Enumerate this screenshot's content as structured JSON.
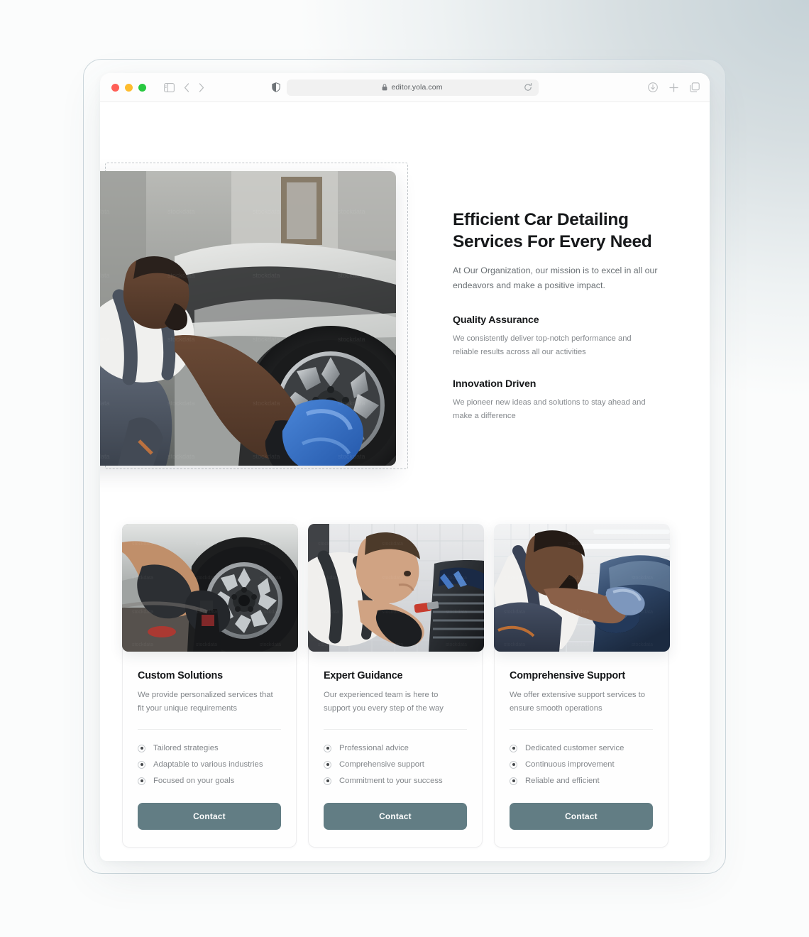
{
  "browser": {
    "traffic_lights": [
      "close",
      "minimize",
      "zoom"
    ],
    "sidebar_toggle": "sidebar-toggle-icon",
    "back_label": "Back",
    "forward_label": "Forward",
    "shield_icon": "shield-icon",
    "url": "editor.yola.com",
    "lock_icon": "lock-icon",
    "reload_icon": "reload-icon",
    "right_icons": [
      "download-icon",
      "new-tab-icon",
      "tab-overview-icon"
    ]
  },
  "hero": {
    "title": "Efficient Car Detailing Services For Every Need",
    "subtitle": "At Our Organization, our mission is to excel in all our endeavors and make a positive impact.",
    "image_alt": "Car detailer cleaning a car wheel with a blue microfiber cloth",
    "features": [
      {
        "title": "Quality Assurance",
        "body": "We consistently deliver top-notch performance and reliable results across all our activities"
      },
      {
        "title": "Innovation Driven",
        "body": "We pioneer new ideas and solutions to stay ahead and make a difference"
      }
    ]
  },
  "cards": [
    {
      "image_alt": "Hands in black gloves polishing a car wheel rim",
      "title": "Custom Solutions",
      "description": "We provide personalized services that fit your unique requirements",
      "bullets": [
        "Tailored strategies",
        "Adaptable to various industries",
        "Focused on your goals"
      ],
      "button": "Contact"
    },
    {
      "image_alt": "Detailer using a red brush on a car front grille",
      "title": "Expert Guidance",
      "description": "Our experienced team is here to support you every step of the way",
      "bullets": [
        "Professional advice",
        "Comprehensive support",
        "Commitment to your success"
      ],
      "button": "Contact"
    },
    {
      "image_alt": "Detailer polishing a blue car door with a machine polisher",
      "title": "Comprehensive Support",
      "description": "We offer extensive support services to ensure smooth operations",
      "bullets": [
        "Dedicated customer service",
        "Continuous improvement",
        "Reliable and efficient"
      ],
      "button": "Contact"
    }
  ],
  "colors": {
    "accent_button": "#627d84",
    "heading": "#16181a",
    "body_text": "#83878b",
    "page_background": "#ffffff",
    "canvas_gradient_top_right": "#c6d2d7"
  }
}
